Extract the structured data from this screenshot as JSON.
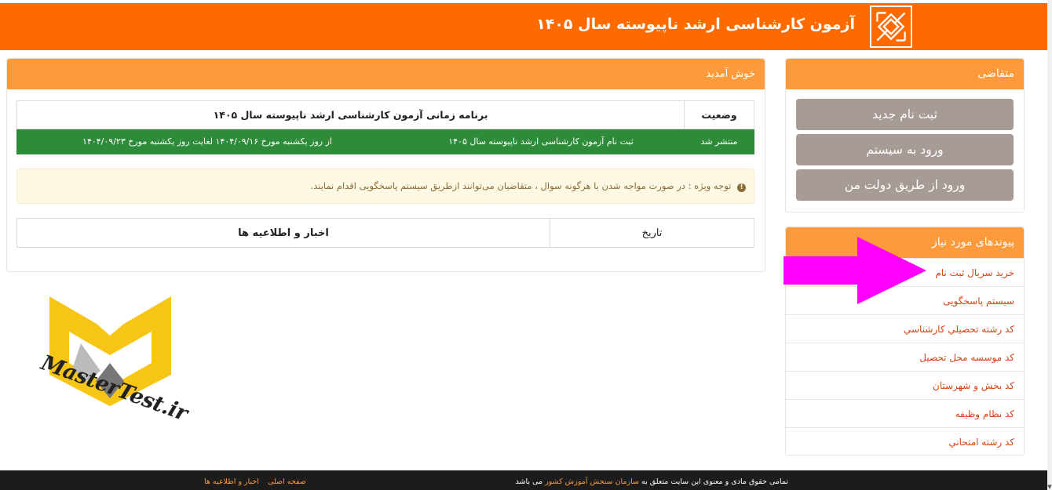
{
  "header": {
    "title": "آزمون کارشناسی ارشد ناپیوسته سال ۱۴۰۵"
  },
  "main": {
    "heading": "خوش آمدید",
    "status_table": {
      "header_status": "وضعیت",
      "header_program": "برنامه زمانی آزمون کارشناسی ارشد ناپیوسته سال ۱۴۰۵",
      "row": {
        "status": "منتشر شد",
        "title": "ثبت نام آزمون کارشناسی ارشد ناپیوسته سال ۱۴۰۵",
        "dates": "از روز یکشنبه مورخ ۱۴۰۴/۰۹/۱۶ لغایت روز یکشنبه مورخ ۱۴۰۴/۰۹/۲۳"
      }
    },
    "notice": "توجه ویژه : در صورت مواجه شدن با هرگونه سوال ، متقاضیان می‌توانند ازطریق سیستم پاسخگویی اقدام نمایند.",
    "news_table": {
      "header_date": "تاریخ",
      "header_news": "اخبار و اطلاعیه ها"
    }
  },
  "sidebar": {
    "applicant": {
      "heading": "متقاضی",
      "buttons": [
        "ثبت نام جدید",
        "ورود به سیستم",
        "ورود از طریق دولت من"
      ]
    },
    "links": {
      "heading": "پیوندهای مورد نیاز",
      "items": [
        "خرید سریال ثبت نام",
        "سیستم پاسخگویی",
        "کد رشته تحصيلي کارشناسي",
        "کد موسسه محل تحصیل",
        "کد بخش و شهرستان",
        "کد نظام وظیفه",
        "کد رشته امتحاني"
      ]
    }
  },
  "watermark": {
    "text": "MasterTest.ir"
  },
  "footer": {
    "rights_prefix": "تمامی حقوق مادی و معنوی این سایت متعلق به",
    "rights_org": "سازمان سنجش آموزش کشور",
    "rights_suffix": "می باشد",
    "links": [
      "صفحه اصلی",
      "اخبار و اطلاعیه ها"
    ]
  },
  "colors": {
    "header": "#fd6b00",
    "panel_heading": "#fd9a3b",
    "button": "#a69b95",
    "status_green": "#2e8b3a",
    "arrow": "#ff00ff",
    "logo_yellow": "#f7c516"
  },
  "icons": {
    "header_logo": "sanjesh-logo-icon",
    "notice": "info-circle-icon",
    "arrow": "magenta-arrow-icon"
  }
}
